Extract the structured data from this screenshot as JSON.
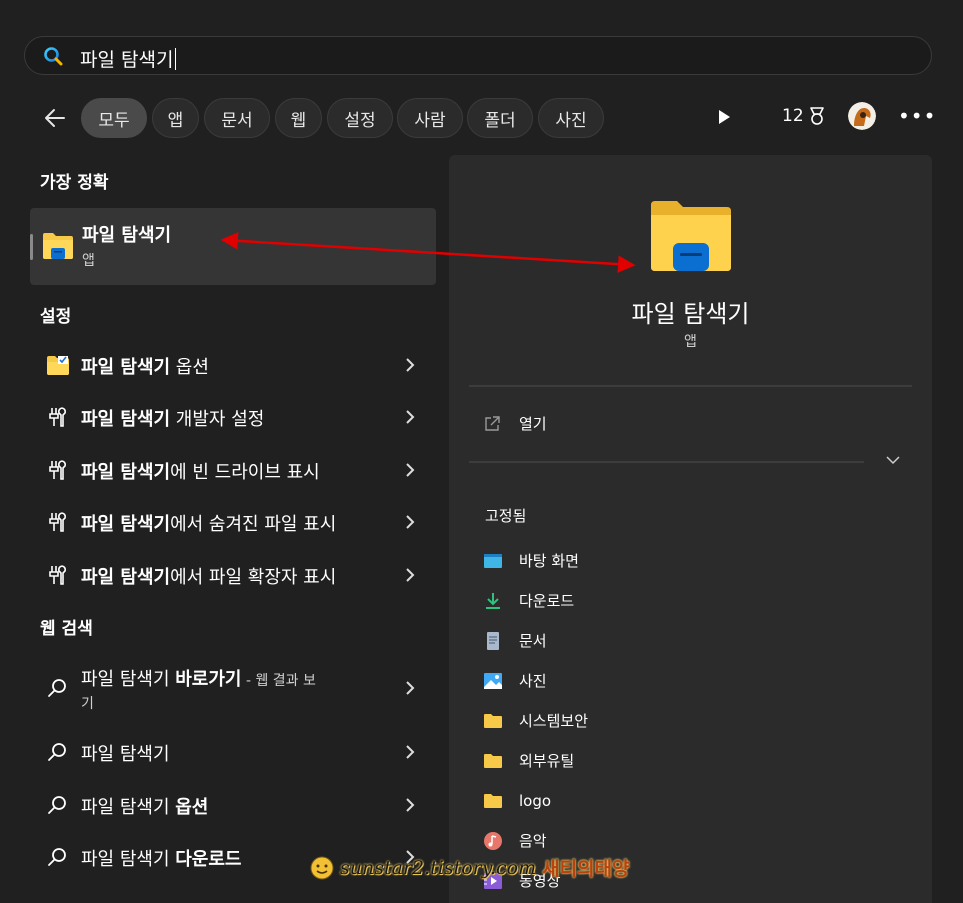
{
  "search": {
    "query": "파일 탐색기"
  },
  "filters": {
    "back_label": "",
    "chips": [
      "모두",
      "앱",
      "문서",
      "웹",
      "설정",
      "사람",
      "폴더",
      "사진"
    ],
    "points": "12"
  },
  "best_match": {
    "heading": "가장 정확",
    "title": "파일 탐색기",
    "subtitle": "앱"
  },
  "settings": {
    "heading": "설정",
    "items": [
      {
        "bold": "파일 탐색기",
        "rest": " 옵션"
      },
      {
        "bold": "파일 탐색기",
        "rest": " 개발자 설정"
      },
      {
        "bold": "파일 탐색기",
        "rest": "에 빈 드라이브 표시"
      },
      {
        "bold": "파일 탐색기",
        "rest": "에서 숨겨진 파일 표시"
      },
      {
        "bold": "파일 탐색기",
        "rest": "에서 파일 확장자 표시"
      }
    ]
  },
  "web": {
    "heading": "웹 검색",
    "items": [
      {
        "plain": "파일 탐색기 ",
        "bold": "바로가기",
        "suffix": " - 웹 결과 보",
        "line2": "기"
      },
      {
        "plain": "파일 탐색기",
        "bold": ""
      },
      {
        "plain": "파일 탐색기 ",
        "bold": "옵션"
      },
      {
        "plain": "파일 탐색기 ",
        "bold": "다운로드"
      }
    ]
  },
  "detail": {
    "title": "파일 탐색기",
    "subtitle": "앱",
    "open_label": "열기",
    "pinned_heading": "고정됨",
    "pinned": [
      "바탕 화면",
      "다운로드",
      "문서",
      "사진",
      "시스템보안",
      "외부유틸",
      "logo",
      "음악",
      "동영상"
    ]
  },
  "watermark": {
    "url": "sunstar2.tistory.com",
    "name": "새티의태양"
  },
  "colors": {
    "background": "#202020",
    "panel": "#2b2b2b",
    "selected_chip": "#4a4a4a",
    "annotation_arrow": "#e00000",
    "folder_yellow": "#f7c948",
    "folder_blue": "#0a6fd1"
  }
}
